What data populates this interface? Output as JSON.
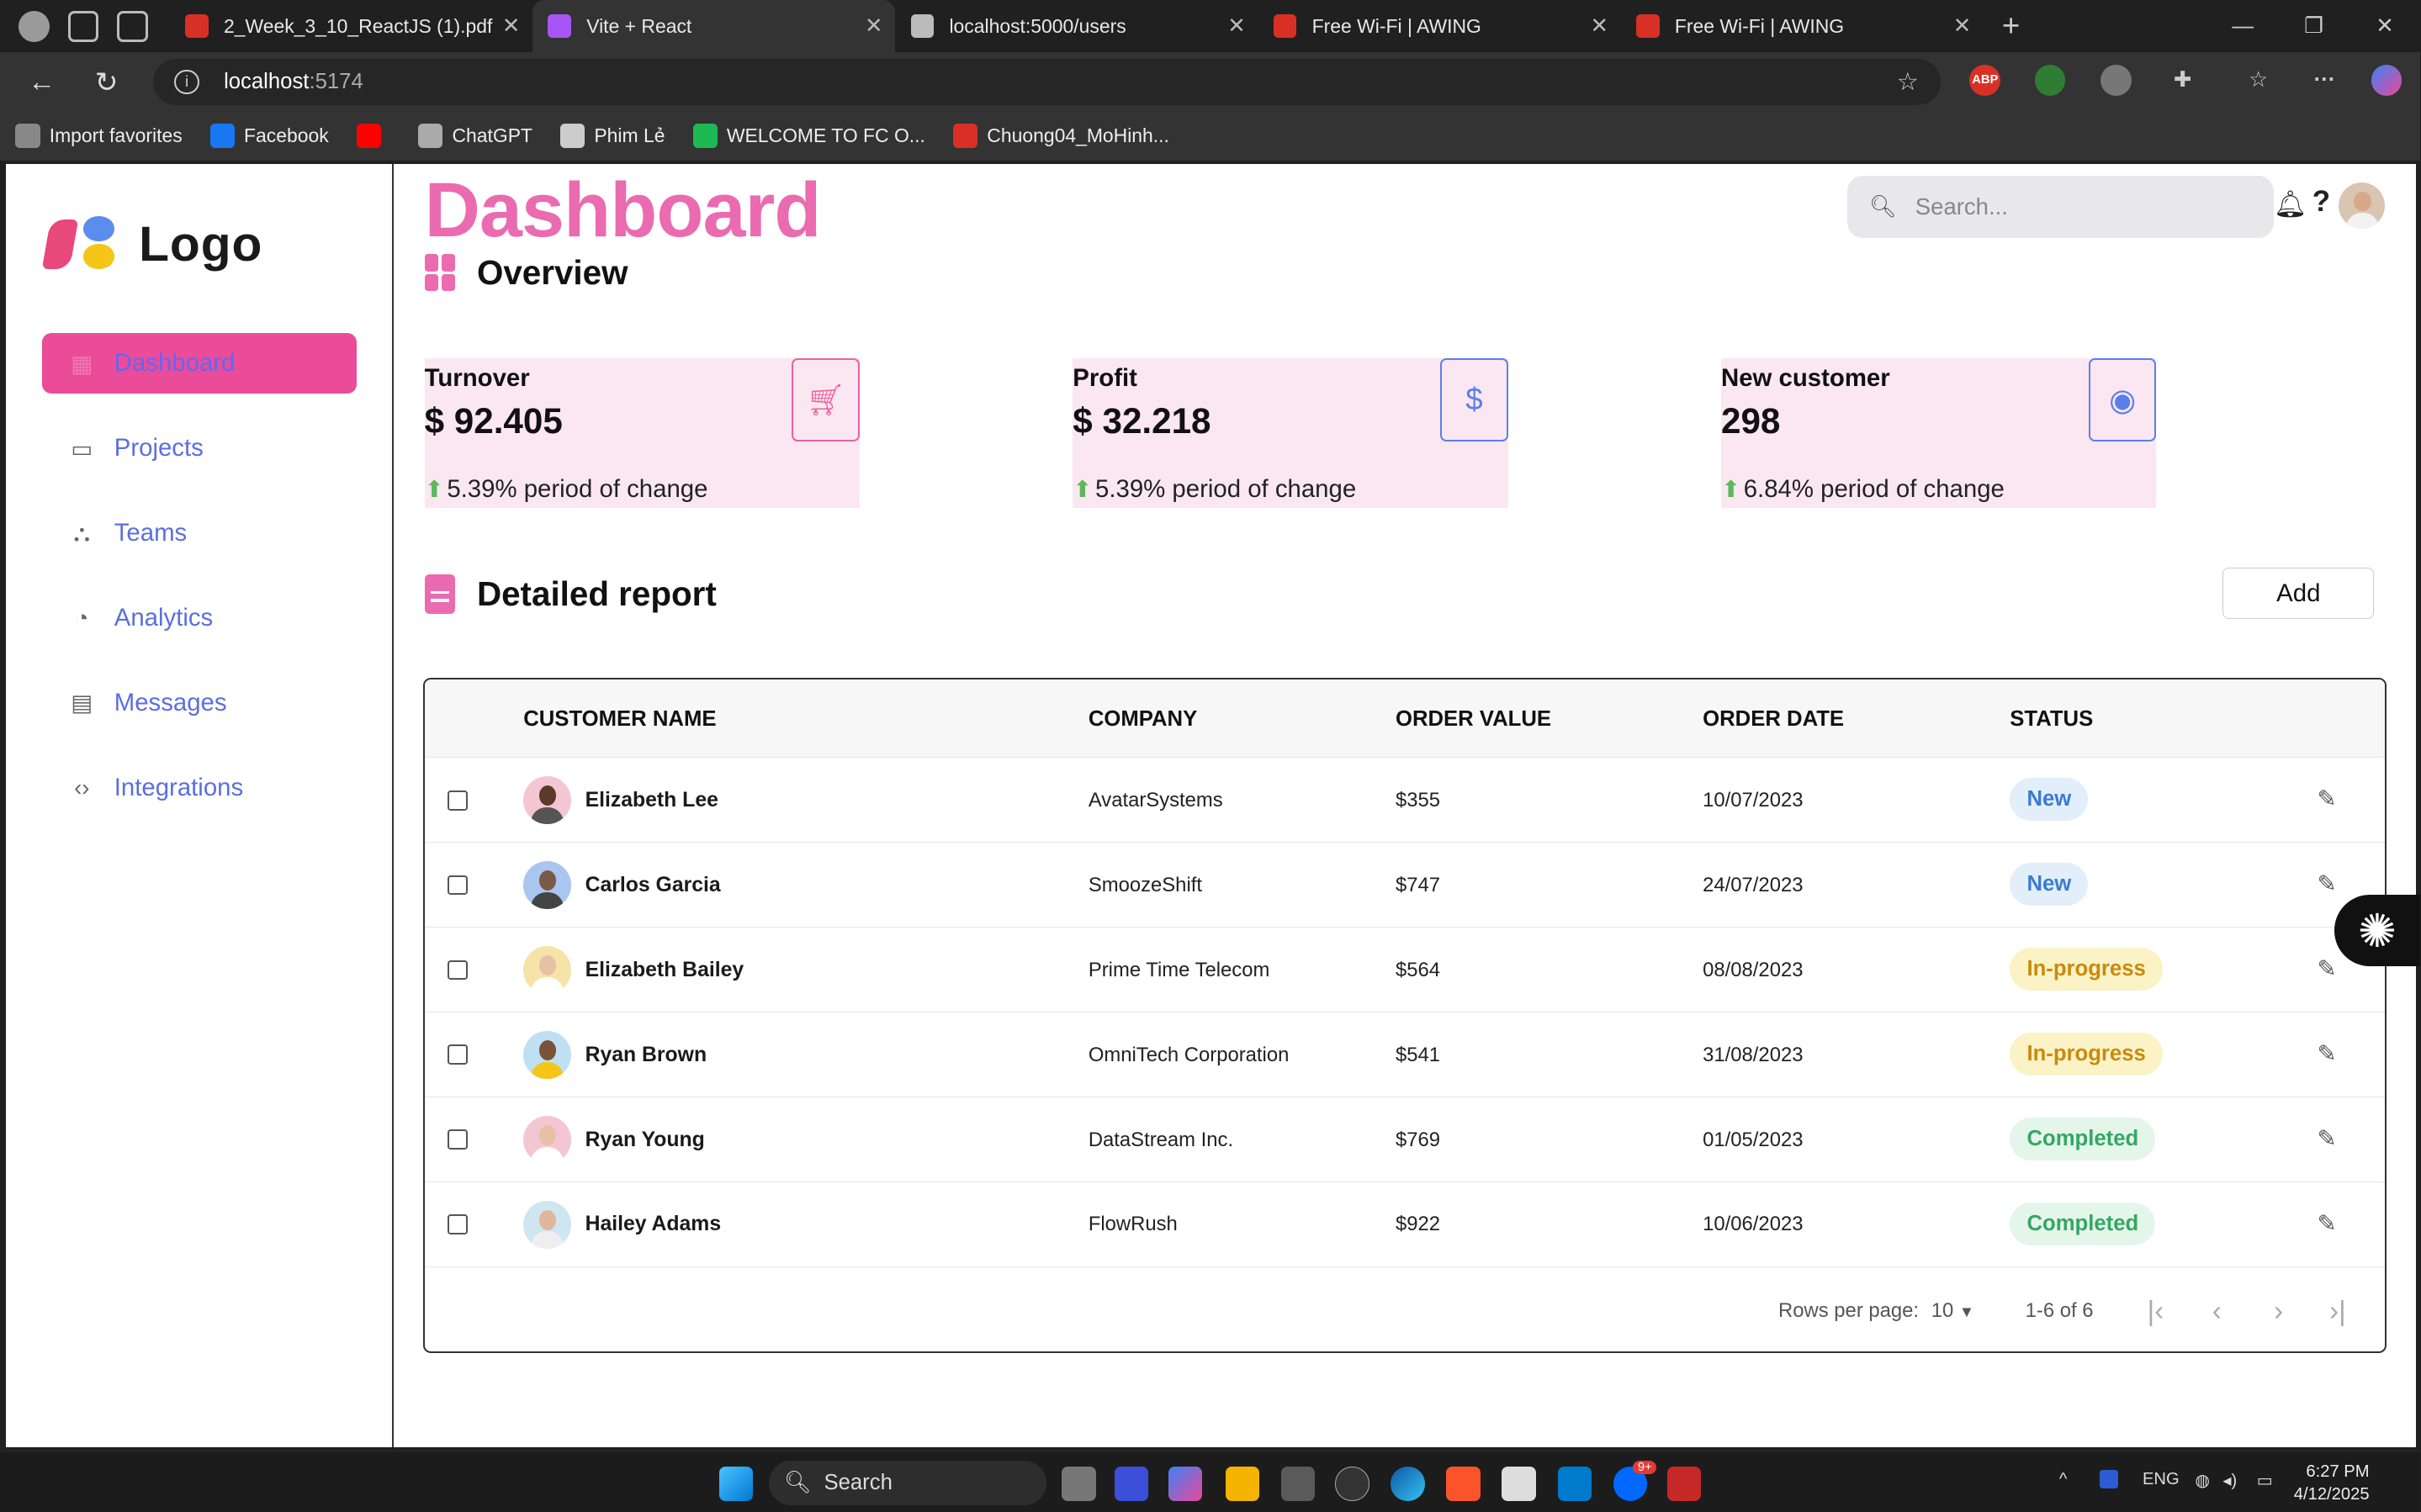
{
  "browser": {
    "tabs": [
      {
        "title": "2_Week_3_10_ReactJS (1).pdf",
        "icon": "pdf-icon",
        "color": "#d93025"
      },
      {
        "title": "Vite + React",
        "icon": "vite-icon",
        "color": "#a855f7",
        "active": true
      },
      {
        "title": "localhost:5000/users",
        "icon": "globe-icon",
        "color": "#bbbbbb"
      },
      {
        "title": "Free Wi-Fi | AWING",
        "icon": "awing-icon",
        "color": "#d93025"
      },
      {
        "title": "Free Wi-Fi | AWING",
        "icon": "awing-icon",
        "color": "#d93025"
      }
    ],
    "url_host": "localhost",
    "url_port": ":5174",
    "bookmarks": [
      {
        "label": "Import favorites",
        "color": "#888888"
      },
      {
        "label": "Facebook",
        "color": "#1877f2"
      },
      {
        "label": "",
        "color": "#ff0000"
      },
      {
        "label": "ChatGPT",
        "color": "#aaaaaa"
      },
      {
        "label": "Phim Lẻ",
        "color": "#cccccc"
      },
      {
        "label": "WELCOME TO FC O...",
        "color": "#1db954"
      },
      {
        "label": "Chuong04_MoHinh...",
        "color": "#d93025"
      }
    ],
    "extensions": [
      {
        "label": "ABP",
        "color": "#d93025"
      }
    ]
  },
  "sidebar": {
    "logo_text": "Logo",
    "items": [
      {
        "label": "Dashboard",
        "icon": "grid-icon",
        "active": true
      },
      {
        "label": "Projects",
        "icon": "folder-icon"
      },
      {
        "label": "Teams",
        "icon": "team-icon"
      },
      {
        "label": "Analytics",
        "icon": "pie-chart-icon"
      },
      {
        "label": "Messages",
        "icon": "message-icon"
      },
      {
        "label": "Integrations",
        "icon": "code-icon"
      }
    ]
  },
  "header": {
    "title": "Dashboard",
    "search_placeholder": "Search...",
    "help_label": "?"
  },
  "overview": {
    "heading": "Overview",
    "cards": [
      {
        "label": "Turnover",
        "value": "$ 92.405",
        "change": "5.39% period of change",
        "icon": "cart-icon",
        "color": "#e8639c"
      },
      {
        "label": "Profit",
        "value": "$ 32.218",
        "change": "5.39% period of change",
        "icon": "dollar-icon",
        "color": "#5b7fe8"
      },
      {
        "label": "New customer",
        "value": "298",
        "change": "6.84% period of change",
        "icon": "user-icon",
        "color": "#5b7fe8"
      }
    ]
  },
  "report": {
    "heading": "Detailed report",
    "add_label": "Add",
    "columns": [
      "CUSTOMER NAME",
      "COMPANY",
      "ORDER VALUE",
      "ORDER DATE",
      "STATUS"
    ],
    "rows": [
      {
        "name": "Elizabeth Lee",
        "company": "AvatarSystems",
        "value": "$355",
        "date": "10/07/2023",
        "status": "New",
        "avatar_bg": "#f4c6d4",
        "skin": "#5a3a2a",
        "shirt": "#555555"
      },
      {
        "name": "Carlos Garcia",
        "company": "SmoozeShift",
        "value": "$747",
        "date": "24/07/2023",
        "status": "New",
        "avatar_bg": "#a9c6ef",
        "skin": "#7a5a44",
        "shirt": "#444444"
      },
      {
        "name": "Elizabeth Bailey",
        "company": "Prime Time Telecom",
        "value": "$564",
        "date": "08/08/2023",
        "status": "In-progress",
        "avatar_bg": "#f6e3a8",
        "skin": "#e7c1a6",
        "shirt": "#ffffff"
      },
      {
        "name": "Ryan Brown",
        "company": "OmniTech Corporation",
        "value": "$541",
        "date": "31/08/2023",
        "status": "In-progress",
        "avatar_bg": "#bfe0f3",
        "skin": "#7a5236",
        "shirt": "#f5c518"
      },
      {
        "name": "Ryan Young",
        "company": "DataStream Inc.",
        "value": "$769",
        "date": "01/05/2023",
        "status": "Completed",
        "avatar_bg": "#f4c6d4",
        "skin": "#e7c1a6",
        "shirt": "#ffffff"
      },
      {
        "name": "Hailey Adams",
        "company": "FlowRush",
        "value": "$922",
        "date": "10/06/2023",
        "status": "Completed",
        "avatar_bg": "#cfe6f1",
        "skin": "#e0b79a",
        "shirt": "#eeeeee"
      }
    ],
    "status_colors": {
      "New": {
        "bg": "#e3eefb",
        "fg": "#3a7bd5"
      },
      "In-progress": {
        "bg": "#fbf3c6",
        "fg": "#c98a0f"
      },
      "Completed": {
        "bg": "#e4f6ea",
        "fg": "#37a664"
      }
    },
    "pager": {
      "rows_label": "Rows per page:",
      "rows_value": "10",
      "range": "1-6 of 6"
    }
  },
  "taskbar": {
    "search_label": "Search",
    "lang": "ENG",
    "time": "6:27 PM",
    "date": "4/12/2025",
    "notif_count": "9+"
  }
}
